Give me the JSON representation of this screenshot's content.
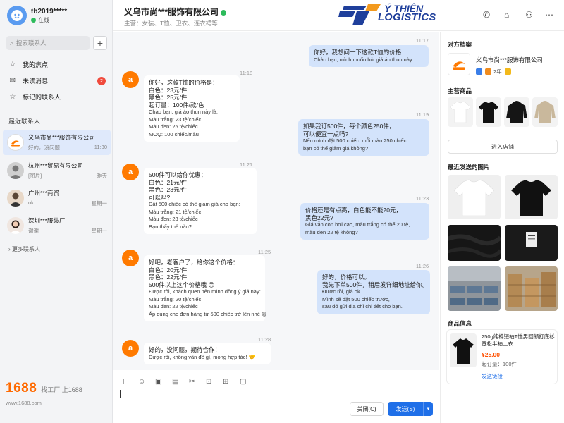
{
  "user": {
    "name": "tb2019*****",
    "status": "在线"
  },
  "search": {
    "placeholder": "搜索联系人",
    "add": "+"
  },
  "nav": [
    {
      "label": "我的焦点",
      "icon": "star-icon"
    },
    {
      "label": "未读消息",
      "icon": "mail-icon",
      "badge": "2"
    },
    {
      "label": "标记的联系人",
      "icon": "star-outline-icon"
    }
  ],
  "recent_title": "最近联系人",
  "contacts": [
    {
      "name": "义乌市尚***服饰有限公司",
      "msg": "好的，没问题",
      "time": "11:30"
    },
    {
      "name": "杭州***贸易有限公司",
      "msg": "[图片]",
      "time": "昨天"
    },
    {
      "name": "广州***商贸",
      "msg": "ok",
      "time": "星期一"
    },
    {
      "name": "深圳***服装厂",
      "msg": "谢谢",
      "time": "星期一"
    }
  ],
  "more": "更多联系人",
  "brand": {
    "logo": "1688",
    "slogan": "找工厂 上1688",
    "url": "www.1688.com"
  },
  "header": {
    "title": "义乌市尚***服饰有限公司",
    "sub": "主营：女装、T恤、卫衣、连衣裙等",
    "logo1": "Ý THIÊN",
    "logo2": "LOGISTICS"
  },
  "messages": [
    {
      "dir": "out",
      "time": "11:17",
      "zh": "你好，我想问一下这款T恤的价格",
      "vi": "Chào bạn, mình muốn hỏi giá áo thun này"
    },
    {
      "dir": "in",
      "time": "11:18",
      "zh": "你好，这款T恤的价格是：\n白色：23元/件\n黑色：25元/件\n起订量：100件/款/色",
      "vi": "Chào bạn, giá áo thun này là:\nMàu trắng: 23 tệ/chiếc\nMàu đen: 25 tệ/chiếc\nMOQ: 100 chiếc/màu"
    },
    {
      "dir": "out",
      "time": "11:19",
      "zh": "如果我订500件，每个颜色250件，\n可以便宜一点吗?",
      "vi": "Nếu mình đặt 500 chiếc, mỗi màu 250 chiếc,\nbạn có thể giảm giá không?"
    },
    {
      "dir": "in",
      "time": "11:21",
      "zh": "500件可以给你优惠：\n白色：21元/件\n黑色：23元/件\n可以吗?",
      "vi": "Đặt 500 chiếc có thể giảm giá cho bạn:\nMàu trắng: 21 tệ/chiếc\nMàu đen: 23 tệ/chiếc\nBạn thấy thế nào?"
    },
    {
      "dir": "out",
      "time": "11:23",
      "zh": "价格还是有点高，白色能不能20元，\n黑色22元?",
      "vi": "Giá vẫn còn hơi cao, màu trắng có thể 20 tệ,\nmàu đen 22 tệ không?"
    },
    {
      "dir": "in",
      "time": "11:25",
      "zh": "好吧，老客户了，给你这个价格：\n白色：20元/件\n黑色：22元/件\n500件以上这个价格哦 😊",
      "vi": "Được rồi, khách quen nên mình đồng ý giá này:\nMàu trắng: 20 tệ/chiếc\nMàu đen: 22 tệ/chiếc\nÁp dụng cho đơn hàng từ 500 chiếc trở lên nhé 😊"
    },
    {
      "dir": "out",
      "time": "11:26",
      "zh": "好的，价格可以。\n我先下单500件，稍后发详细地址给你。",
      "vi": "Được rồi, giá ok.\nMình sẽ đặt 500 chiếc trước,\nsau đó gửi địa chỉ chi tiết cho bạn."
    },
    {
      "dir": "in",
      "time": "11:28",
      "zh": "好的，没问题，期待合作！",
      "vi": "Được rồi, không vấn đề gì, mong hợp tác! 🤝"
    }
  ],
  "input": {
    "close": "关闭(C)",
    "send": "发送(S)"
  },
  "right": {
    "profile_title": "对方档案",
    "company": "义乌市尚***服饰有限公司",
    "years": "2年",
    "main_products": "主营商品",
    "enter_store": "进入店铺",
    "recent_images": "最近发送的图片",
    "product_info": "商品信息",
    "product": {
      "name": "250g纯棉短袖T恤男圆领打底衫宽松半袖上衣",
      "price": "¥25.00",
      "moq": "起订量：100件",
      "link": "发送链接"
    }
  }
}
